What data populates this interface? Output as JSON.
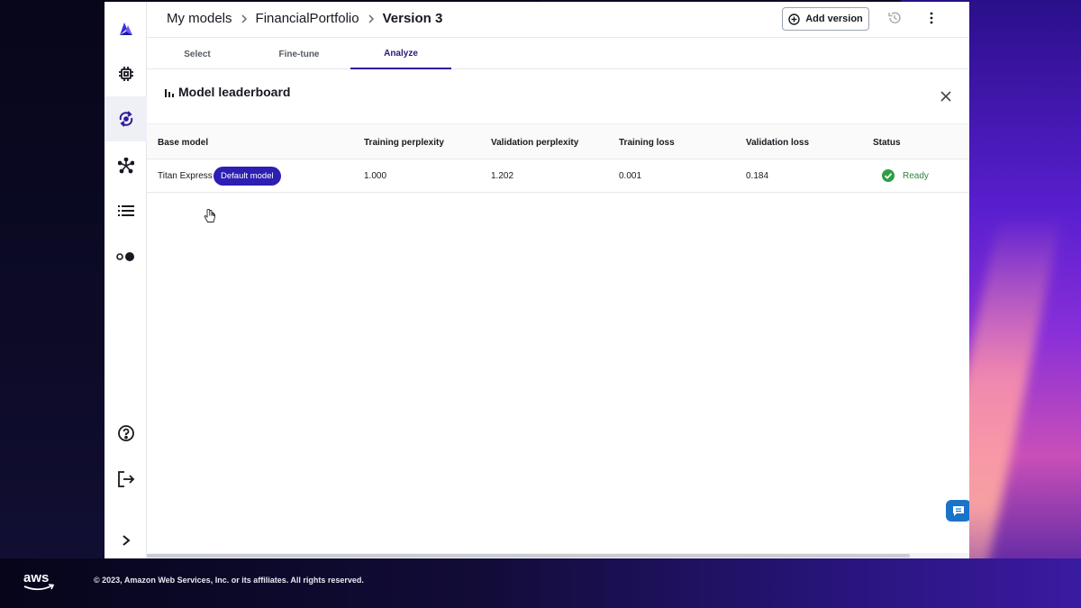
{
  "breadcrumb": {
    "items": [
      "My models",
      "FinancialPortfolio",
      "Version 3"
    ]
  },
  "header": {
    "add_version_label": "Add version"
  },
  "tabs": [
    {
      "label": "Select",
      "active": false
    },
    {
      "label": "Fine-tune",
      "active": false
    },
    {
      "label": "Analyze",
      "active": true
    }
  ],
  "leaderboard": {
    "title": "Model leaderboard",
    "columns": [
      "Base model",
      "Training perplexity",
      "Validation perplexity",
      "Training loss",
      "Validation loss",
      "Status"
    ],
    "rows": [
      {
        "base_model": "Titan Express",
        "badge": "Default model",
        "training_perplexity": "1.000",
        "validation_perplexity": "1.202",
        "training_loss": "0.001",
        "validation_loss": "0.184",
        "status": "Ready"
      }
    ]
  },
  "sidebar": {
    "icons": [
      "logo-icon",
      "chip-icon",
      "refresh-icon",
      "cluster-icon",
      "list-icon",
      "toggle-icon",
      "help-icon",
      "logout-icon",
      "chevron-right-icon"
    ],
    "active": "refresh-icon"
  },
  "footer": {
    "logo_text": "aws",
    "copyright": "© 2023, Amazon Web Services, Inc. or its affiliates. All rights reserved."
  },
  "colors": {
    "accent": "#2d1fb3",
    "tab_active": "#2a1a99",
    "status_ready": "#2e8540",
    "chat": "#1a73c9"
  }
}
